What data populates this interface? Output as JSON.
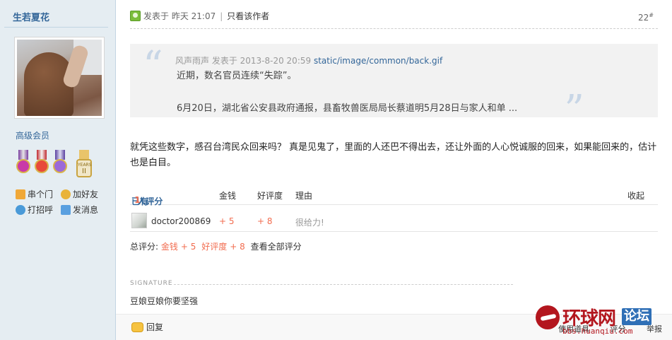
{
  "sidebar": {
    "username": "生若夏花",
    "user_group": "高级会员",
    "links": [
      "串个门",
      "加好友",
      "打招呼",
      "发消息"
    ],
    "medal_year_label": "YEARS",
    "medal_year_num": "II"
  },
  "post": {
    "posted_label": "发表于 昨天 21:07",
    "author_only": "只看该作者",
    "floor": "22",
    "floor_sup": "#",
    "quote": {
      "meta": "风声雨声 发表于 2013-8-20 20:59",
      "path": "static/image/common/back.gif",
      "line1": "近期，数名官员连续“失踪”。",
      "line2": "6月20日，湖北省公安县政府通报，县畜牧兽医局局长蔡道明5月28日与家人和单 ..."
    },
    "body": "就凭这些数字，感召台湾民众回来吗？ 真是见鬼了，里面的人还巴不得出去，还让外面的人心悦诚服的回来，如果能回来的，估计也是白目。"
  },
  "rating": {
    "prefix": "已有",
    "count": "1",
    "suffix": "人评分",
    "col_money": "金钱",
    "col_rep": "好评度",
    "col_reason": "理由",
    "collapse": "收起",
    "rows": [
      {
        "user": "doctor200869",
        "money": "+ 5",
        "rep": "+ 8",
        "reason": "很给力!"
      }
    ],
    "total_label": "总评分:",
    "total_money_label": "金钱",
    "total_money": "+ 5",
    "total_rep_label": "好评度",
    "total_rep": "+ 8",
    "view_all": "查看全部评分"
  },
  "signature": {
    "label": "SIGNATURE",
    "text": "豆娘豆娘你要坚强"
  },
  "footer": {
    "reply": "回复",
    "use_tool": "使用道具",
    "rate": "评分",
    "report": "举报"
  },
  "watermark": {
    "name": "环球网",
    "badge": "论坛",
    "url": "bbs.huanqiu.com"
  },
  "colors": {
    "accent": "#336699",
    "plus": "#f26c4f",
    "sidebar_bg": "#e5edf2"
  }
}
